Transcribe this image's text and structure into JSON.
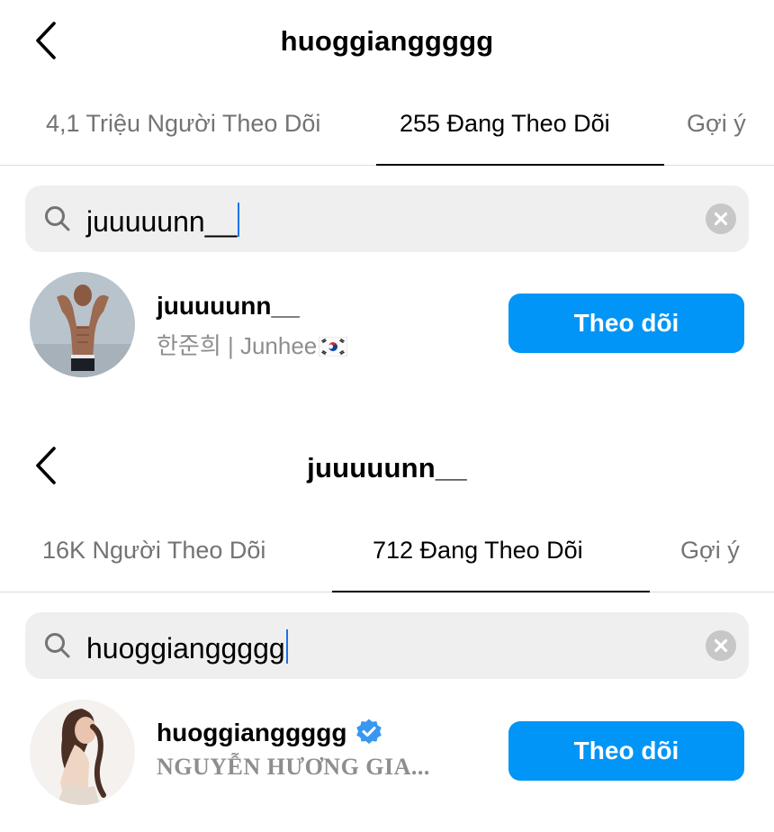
{
  "panels": [
    {
      "title": "huoggianggggg",
      "tabs": [
        {
          "label": "4,1 Triệu Người Theo Dõi",
          "active": false
        },
        {
          "label": "255 Đang Theo Dõi",
          "active": true
        },
        {
          "label": "Gợi ý",
          "active": false
        }
      ],
      "search": {
        "query": "juuuuunn__"
      },
      "result": {
        "username": "juuuuunn__",
        "fullname": "한준희 | Junhee",
        "flag": "south-korea-flag-icon",
        "verified": false,
        "button_label": "Theo dõi"
      }
    },
    {
      "title": "juuuuunn__",
      "tabs": [
        {
          "label": "16K Người Theo Dõi",
          "active": false
        },
        {
          "label": "712 Đang Theo Dõi",
          "active": true
        },
        {
          "label": "Gợi ý",
          "active": false
        }
      ],
      "search": {
        "query": "huoggianggggg"
      },
      "result": {
        "username": "huoggianggggg",
        "fullname": "NGUYỄN HƯƠNG GIA...",
        "verified": true,
        "button_label": "Theo dõi"
      }
    }
  ],
  "colors": {
    "accent": "#0095f6",
    "search_bg": "#efefef",
    "muted_text": "#737373",
    "verified_badge": "#3897f0"
  },
  "icons": [
    "back-chevron-icon",
    "search-icon",
    "clear-icon",
    "verified-badge-icon",
    "south-korea-flag-icon"
  ]
}
